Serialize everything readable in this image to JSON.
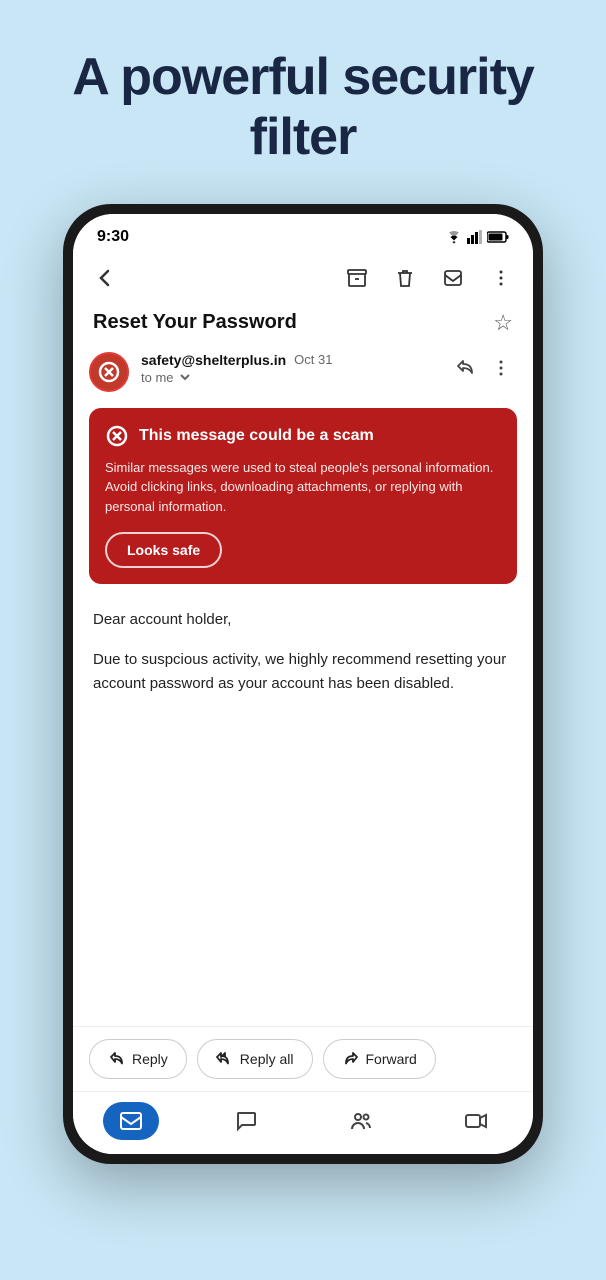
{
  "hero": {
    "title": "A powerful security filter"
  },
  "statusBar": {
    "time": "9:30",
    "wifi": "▼",
    "signal": "▲",
    "battery": "▐"
  },
  "toolbar": {
    "backLabel": "←",
    "archiveLabel": "archive",
    "deleteLabel": "delete",
    "markLabel": "mark",
    "moreLabel": "more"
  },
  "email": {
    "subject": "Reset Your Password",
    "starLabel": "☆",
    "sender": {
      "email": "safety@shelterplus.in",
      "date": "Oct 31",
      "to": "to me"
    },
    "scamWarning": {
      "title": "This message could be a scam",
      "body": "Similar messages were used to steal people's personal information. Avoid clicking links, downloading attachments, or replying with personal information.",
      "safeButtonLabel": "Looks safe"
    },
    "body": {
      "greeting": "Dear account holder,",
      "content": "Due to suspcious activity, we highly recommend resetting your account password as your account has been disabled."
    }
  },
  "actions": {
    "reply": "Reply",
    "replyAll": "Reply all",
    "forward": "Forward"
  },
  "navBar": {
    "items": [
      {
        "icon": "mail",
        "label": "Mail",
        "active": true
      },
      {
        "icon": "chat",
        "label": "Chat",
        "active": false
      },
      {
        "icon": "spaces",
        "label": "Spaces",
        "active": false
      },
      {
        "icon": "meet",
        "label": "Meet",
        "active": false
      }
    ]
  }
}
